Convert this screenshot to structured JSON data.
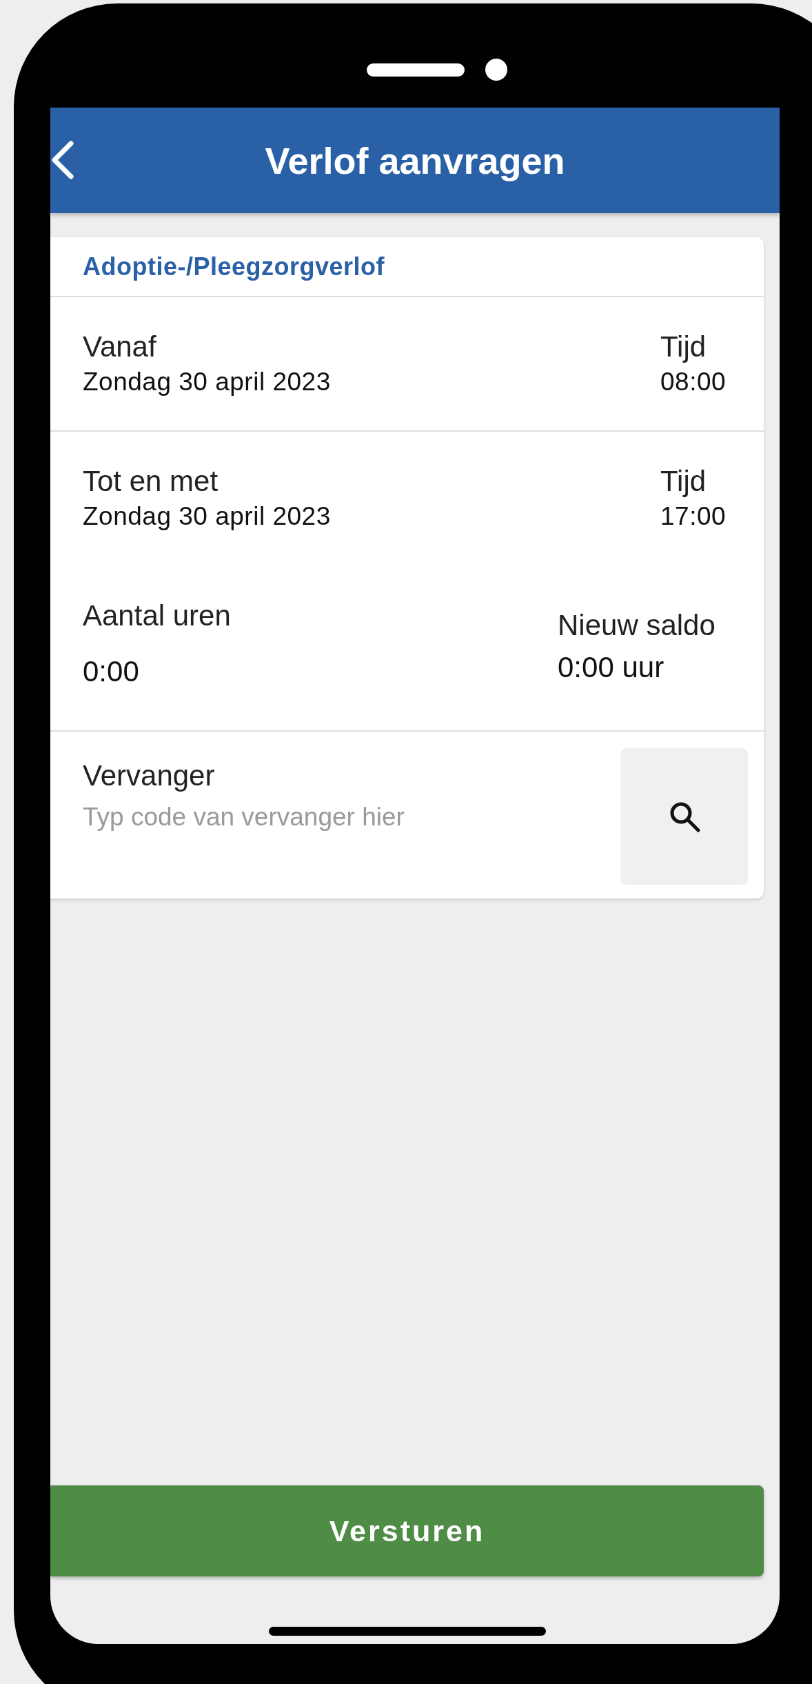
{
  "header": {
    "title": "Verlof aanvragen"
  },
  "card": {
    "title": "Adoptie-/Pleegzorgverlof",
    "periods": [
      {
        "label": "Vanaf",
        "date": "Zondag 30 april 2023",
        "time_label": "Tijd",
        "time": "08:00"
      },
      {
        "label": "Tot en met",
        "date": "Zondag 30 april 2023",
        "time_label": "Tijd",
        "time": "17:00"
      }
    ],
    "hours": {
      "label": "Aantal uren",
      "value": "0:00",
      "balance_label": "Nieuw saldo",
      "balance": "0:00 uur"
    },
    "substitute": {
      "label": "Vervanger",
      "placeholder": "Typ code van vervanger hier"
    }
  },
  "submit": {
    "label": "Versturen"
  }
}
